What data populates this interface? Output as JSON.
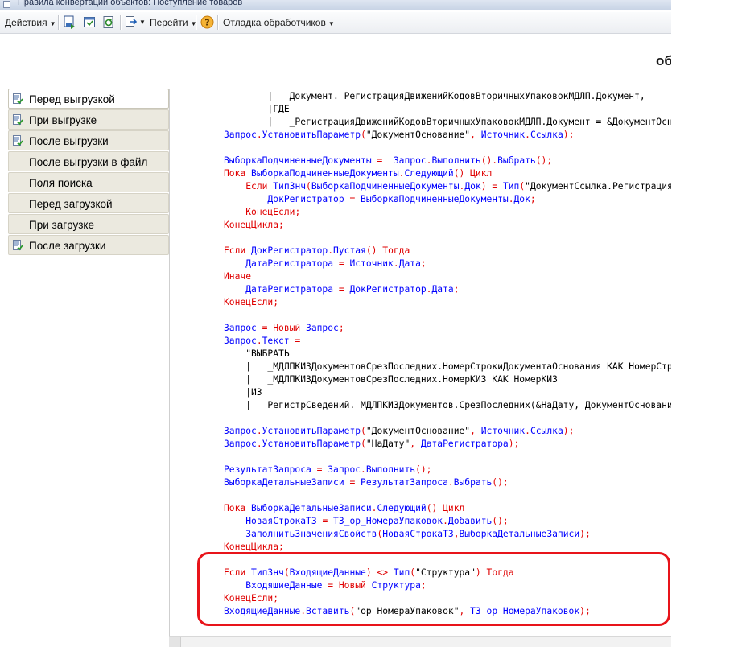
{
  "window": {
    "title": "Правила конвертации объектов: Поступление товаров",
    "heading_fragment": "об"
  },
  "toolbar": {
    "actions_label": "Действия",
    "goto_label": "Перейти",
    "debug_label": "Отладка обработчиков"
  },
  "tabs": [
    {
      "label": "Перед выгрузкой",
      "has_icon": true,
      "active": true
    },
    {
      "label": "При выгрузке",
      "has_icon": true,
      "active": false
    },
    {
      "label": "После выгрузки",
      "has_icon": true,
      "active": false
    },
    {
      "label": "После выгрузки в файл",
      "has_icon": false,
      "active": false
    },
    {
      "label": "Поля поиска",
      "has_icon": false,
      "active": false
    },
    {
      "label": "Перед загрузкой",
      "has_icon": false,
      "active": false
    },
    {
      "label": "При загрузке",
      "has_icon": false,
      "active": false
    },
    {
      "label": "После загрузки",
      "has_icon": true,
      "active": false
    }
  ],
  "code_lines": [
    [
      [
        "txt",
        "        |   Документ._РегистрацияДвиженийКодовВторичныхУпаковокМДЛП.Документ,"
      ]
    ],
    [
      [
        "txt",
        "        |ГДЕ"
      ]
    ],
    [
      [
        "txt",
        "        |   _РегистрацияДвиженийКодовВторичныхУпаковокМДЛП.Документ = &ДокументОснование\""
      ]
    ],
    [
      [
        "id",
        "Запрос"
      ],
      [
        "op",
        "."
      ],
      [
        "id",
        "УстановитьПараметр"
      ],
      [
        "op",
        "("
      ],
      [
        "txt",
        "\"ДокументОснование\""
      ],
      [
        "op",
        ", "
      ],
      [
        "id",
        "Источник"
      ],
      [
        "op",
        "."
      ],
      [
        "id",
        "Ссылка"
      ],
      [
        "op",
        ");"
      ]
    ],
    [],
    [
      [
        "id",
        "ВыборкаПодчиненныеДокументы"
      ],
      [
        "op",
        " =  "
      ],
      [
        "id",
        "Запрос"
      ],
      [
        "op",
        "."
      ],
      [
        "id",
        "Выполнить"
      ],
      [
        "op",
        "()."
      ],
      [
        "id",
        "Выбрать"
      ],
      [
        "op",
        "();"
      ]
    ],
    [
      [
        "kw",
        "Пока "
      ],
      [
        "id",
        "ВыборкаПодчиненныеДокументы"
      ],
      [
        "op",
        "."
      ],
      [
        "id",
        "Следующий"
      ],
      [
        "op",
        "() "
      ],
      [
        "kw",
        "Цикл"
      ]
    ],
    [
      [
        "txt",
        "    "
      ],
      [
        "kw",
        "Если "
      ],
      [
        "id",
        "ТипЗнч"
      ],
      [
        "op",
        "("
      ],
      [
        "id",
        "ВыборкаПодчиненныеДокументы"
      ],
      [
        "op",
        "."
      ],
      [
        "id",
        "Док"
      ],
      [
        "op",
        ") = "
      ],
      [
        "id",
        "Тип"
      ],
      [
        "op",
        "("
      ],
      [
        "txt",
        "\"ДокументСсылка.РегистрацияДвижений\""
      ]
    ],
    [
      [
        "txt",
        "        "
      ],
      [
        "id",
        "ДокРегистратор"
      ],
      [
        "op",
        " = "
      ],
      [
        "id",
        "ВыборкаПодчиненныеДокументы"
      ],
      [
        "op",
        "."
      ],
      [
        "id",
        "Док"
      ],
      [
        "op",
        ";"
      ]
    ],
    [
      [
        "txt",
        "    "
      ],
      [
        "kw",
        "КонецЕсли"
      ],
      [
        "op",
        ";"
      ]
    ],
    [
      [
        "kw",
        "КонецЦикла"
      ],
      [
        "op",
        ";"
      ]
    ],
    [],
    [
      [
        "kw",
        "Если "
      ],
      [
        "id",
        "ДокРегистратор"
      ],
      [
        "op",
        "."
      ],
      [
        "id",
        "Пустая"
      ],
      [
        "op",
        "() "
      ],
      [
        "kw",
        "Тогда"
      ]
    ],
    [
      [
        "txt",
        "    "
      ],
      [
        "id",
        "ДатаРегистратора"
      ],
      [
        "op",
        " = "
      ],
      [
        "id",
        "Источник"
      ],
      [
        "op",
        "."
      ],
      [
        "id",
        "Дата"
      ],
      [
        "op",
        ";"
      ]
    ],
    [
      [
        "kw",
        "Иначе"
      ]
    ],
    [
      [
        "txt",
        "    "
      ],
      [
        "id",
        "ДатаРегистратора"
      ],
      [
        "op",
        " = "
      ],
      [
        "id",
        "ДокРегистратор"
      ],
      [
        "op",
        "."
      ],
      [
        "id",
        "Дата"
      ],
      [
        "op",
        ";"
      ]
    ],
    [
      [
        "kw",
        "КонецЕсли"
      ],
      [
        "op",
        ";"
      ]
    ],
    [],
    [
      [
        "id",
        "Запрос"
      ],
      [
        "op",
        " = "
      ],
      [
        "kw",
        "Новый "
      ],
      [
        "id",
        "Запрос"
      ],
      [
        "op",
        ";"
      ]
    ],
    [
      [
        "id",
        "Запрос"
      ],
      [
        "op",
        "."
      ],
      [
        "id",
        "Текст"
      ],
      [
        "op",
        " ="
      ]
    ],
    [
      [
        "txt",
        "    \"ВЫБРАТЬ"
      ]
    ],
    [
      [
        "txt",
        "    |   _МДЛПКИЗДокументовСрезПоследних.НомерСтрокиДокументаОснования КАК НомерСтроки,"
      ]
    ],
    [
      [
        "txt",
        "    |   _МДЛПКИЗДокументовСрезПоследних.НомерКИЗ КАК НомерКИЗ"
      ]
    ],
    [
      [
        "txt",
        "    |ИЗ"
      ]
    ],
    [
      [
        "txt",
        "    |   РегистрСведений._МДЛПКИЗДокументов.СрезПоследних(&НаДату, ДокументОснование = &ДокументОснование)"
      ]
    ],
    [],
    [
      [
        "id",
        "Запрос"
      ],
      [
        "op",
        "."
      ],
      [
        "id",
        "УстановитьПараметр"
      ],
      [
        "op",
        "("
      ],
      [
        "txt",
        "\"ДокументОснование\""
      ],
      [
        "op",
        ", "
      ],
      [
        "id",
        "Источник"
      ],
      [
        "op",
        "."
      ],
      [
        "id",
        "Ссылка"
      ],
      [
        "op",
        ");"
      ]
    ],
    [
      [
        "id",
        "Запрос"
      ],
      [
        "op",
        "."
      ],
      [
        "id",
        "УстановитьПараметр"
      ],
      [
        "op",
        "("
      ],
      [
        "txt",
        "\"НаДату\""
      ],
      [
        "op",
        ", "
      ],
      [
        "id",
        "ДатаРегистратора"
      ],
      [
        "op",
        ");"
      ]
    ],
    [],
    [
      [
        "id",
        "РезультатЗапроса"
      ],
      [
        "op",
        " = "
      ],
      [
        "id",
        "Запрос"
      ],
      [
        "op",
        "."
      ],
      [
        "id",
        "Выполнить"
      ],
      [
        "op",
        "();"
      ]
    ],
    [
      [
        "id",
        "ВыборкаДетальныеЗаписи"
      ],
      [
        "op",
        " = "
      ],
      [
        "id",
        "РезультатЗапроса"
      ],
      [
        "op",
        "."
      ],
      [
        "id",
        "Выбрать"
      ],
      [
        "op",
        "();"
      ]
    ],
    [],
    [
      [
        "kw",
        "Пока "
      ],
      [
        "id",
        "ВыборкаДетальныеЗаписи"
      ],
      [
        "op",
        "."
      ],
      [
        "id",
        "Следующий"
      ],
      [
        "op",
        "() "
      ],
      [
        "kw",
        "Цикл"
      ]
    ],
    [
      [
        "txt",
        "    "
      ],
      [
        "id",
        "НоваяСтрокаТЗ"
      ],
      [
        "op",
        " = "
      ],
      [
        "id",
        "ТЗ_ор_НомераУпаковок"
      ],
      [
        "op",
        "."
      ],
      [
        "id",
        "Добавить"
      ],
      [
        "op",
        "();"
      ]
    ],
    [
      [
        "txt",
        "    "
      ],
      [
        "id",
        "ЗаполнитьЗначенияСвойств"
      ],
      [
        "op",
        "("
      ],
      [
        "id",
        "НоваяСтрокаТЗ"
      ],
      [
        "op",
        ","
      ],
      [
        "id",
        "ВыборкаДетальныеЗаписи"
      ],
      [
        "op",
        ");"
      ]
    ],
    [
      [
        "kw",
        "КонецЦикла"
      ],
      [
        "op",
        ";"
      ]
    ],
    [],
    [
      [
        "kw",
        "Если "
      ],
      [
        "id",
        "ТипЗнч"
      ],
      [
        "op",
        "("
      ],
      [
        "id",
        "ВходящиеДанные"
      ],
      [
        "op",
        ") <> "
      ],
      [
        "id",
        "Тип"
      ],
      [
        "op",
        "("
      ],
      [
        "txt",
        "\"Структура\""
      ],
      [
        "op",
        ") "
      ],
      [
        "kw",
        "Тогда"
      ]
    ],
    [
      [
        "txt",
        "    "
      ],
      [
        "id",
        "ВходящиеДанные"
      ],
      [
        "op",
        " = "
      ],
      [
        "kw",
        "Новый "
      ],
      [
        "id",
        "Структура"
      ],
      [
        "op",
        ";"
      ]
    ],
    [
      [
        "kw",
        "КонецЕсли"
      ],
      [
        "op",
        ";"
      ]
    ],
    [
      [
        "id",
        "ВходящиеДанные"
      ],
      [
        "op",
        "."
      ],
      [
        "id",
        "Вставить"
      ],
      [
        "op",
        "("
      ],
      [
        "txt",
        "\"ор_НомераУпаковок\""
      ],
      [
        "op",
        ", "
      ],
      [
        "id",
        "ТЗ_ор_НомераУпаковок"
      ],
      [
        "op",
        ");"
      ]
    ]
  ],
  "colors": {
    "keyword": "#e00000",
    "identifier": "#0000ff",
    "highlight": "#e8141a"
  }
}
